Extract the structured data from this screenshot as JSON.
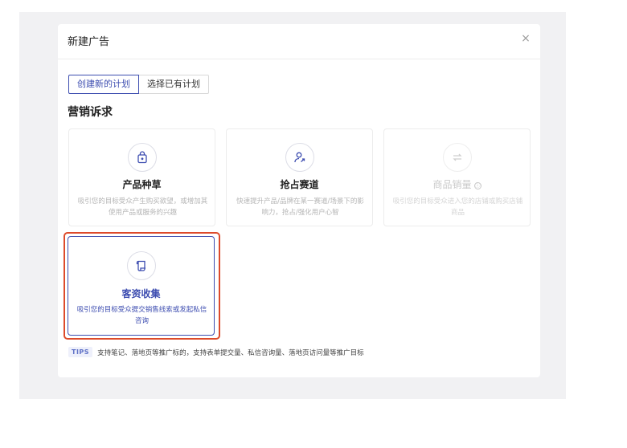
{
  "modal": {
    "title": "新建广告",
    "close_label": "×"
  },
  "tabs": [
    {
      "label": "创建新的计划",
      "active": true
    },
    {
      "label": "选择已有计划",
      "active": false
    }
  ],
  "section_title": "营销诉求",
  "cards": [
    {
      "title": "产品种草",
      "desc": "吸引您的目标受众产生购买欲望，或增加其使用产品或服务的兴趣",
      "icon": "lock-bag-icon",
      "state": "normal"
    },
    {
      "title": "抢占赛道",
      "desc": "快速提升产品/品牌在某一赛道/场景下的影响力，抢占/强化用户心智",
      "icon": "user-arrow-icon",
      "state": "normal"
    },
    {
      "title": "商品销量",
      "info_icon": "ⓘ",
      "desc": "吸引您的目标受众进入您的店铺或购买店铺商品",
      "icon": "refresh-icon",
      "state": "disabled"
    },
    {
      "title": "客资收集",
      "desc": "吸引您的目标受众提交销售线索或发起私信咨询",
      "icon": "scroll-icon",
      "state": "selected"
    }
  ],
  "tips": {
    "badge": "TIPS",
    "text": "支持笔记、落地页等推广标的，支持表单提交量、私信咨询量、落地页访问量等推广目标"
  },
  "colors": {
    "primary": "#3d4db0",
    "highlight": "#dd4a2b",
    "backdrop": "#f1f1f3"
  }
}
